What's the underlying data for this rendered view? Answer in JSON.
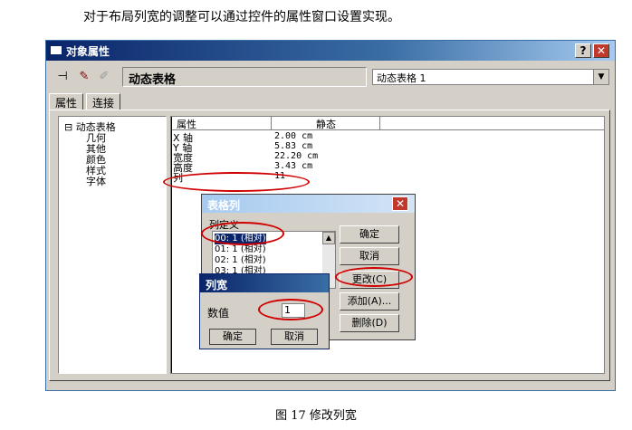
{
  "doc": {
    "intro_text": "对于布局列宽的调整可以通过控件的属性窗口设置实现。",
    "figure_caption": "图 17  修改列宽"
  },
  "window": {
    "title": "对象属性",
    "help_label": "?",
    "close_label": "✕",
    "toolbar": {
      "pin_glyph": "⊣",
      "tool2_glyph": "✎",
      "tool3_glyph": "✐",
      "object_name": "动态表格",
      "object_combo_value": "动态表格 1",
      "combo_arrow": "▼"
    },
    "tabs": [
      "属性",
      "连接"
    ]
  },
  "tree": {
    "root_toggle": "⊟",
    "root": "动态表格",
    "children": [
      "几何",
      "其他",
      "颜色",
      "样式",
      "字体"
    ]
  },
  "grid": {
    "header_name": "属性",
    "header_value": "静态",
    "rows": [
      {
        "name": "X 轴",
        "value": "2.00 cm"
      },
      {
        "name": "Y 轴",
        "value": "5.83 cm"
      },
      {
        "name": "宽度",
        "value": "22.20 cm"
      },
      {
        "name": "高度",
        "value": "3.43 cm"
      },
      {
        "name": "列",
        "value": "11"
      }
    ]
  },
  "table_dialog": {
    "title": "表格列",
    "close_label": "✕",
    "group_label": "列定义",
    "list_items": [
      "00: 1 (相对)",
      "01: 1 (相对)",
      "02: 1 (相对)",
      "03: 1 (相对)"
    ],
    "scroll_up": "▲",
    "buttons": {
      "ok": "确定",
      "cancel": "取消",
      "modify": "更改(C)",
      "add": "添加(A)...",
      "delete": "删除(D)"
    }
  },
  "width_dialog": {
    "title": "列宽",
    "value_label": "数值",
    "value": "1",
    "ok": "确定",
    "cancel": "取消"
  },
  "colors": {
    "highlight_ellipse": "#d00000",
    "titlebar_active": "#0a246a",
    "titlebar_inactive": "#a6caf0",
    "face": "#d4d0c8"
  }
}
